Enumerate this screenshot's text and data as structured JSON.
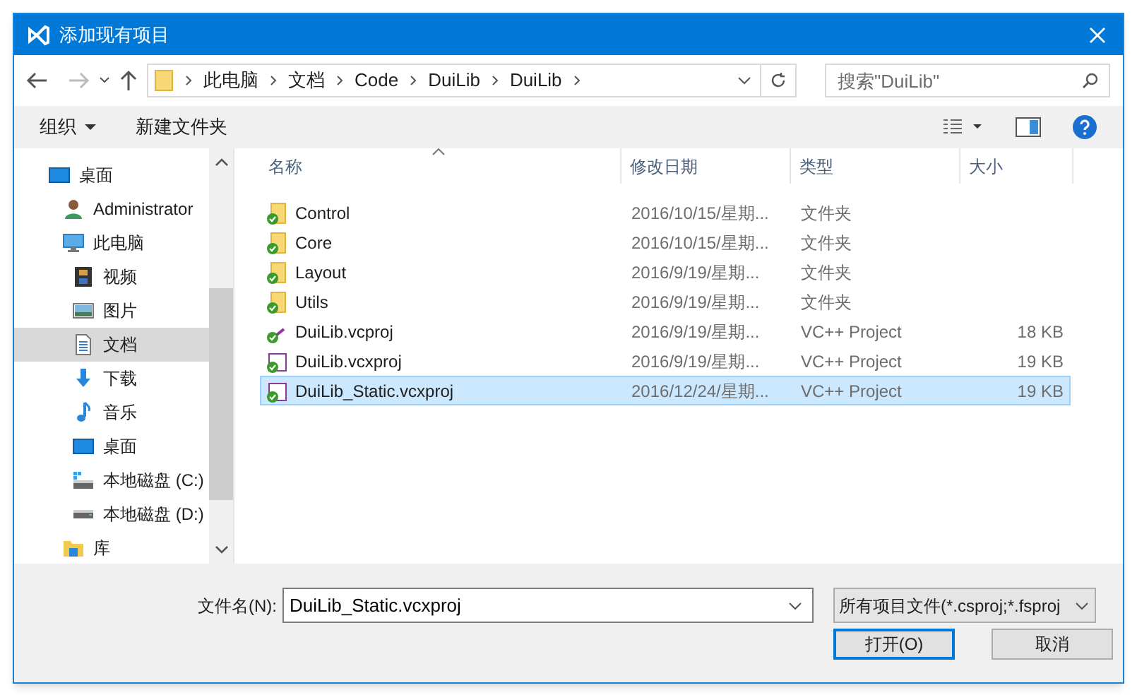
{
  "window": {
    "title": "添加现有项目"
  },
  "address": {
    "segments": [
      "此电脑",
      "文档",
      "Code",
      "DuiLib",
      "DuiLib"
    ]
  },
  "search": {
    "placeholder": "搜索\"DuiLib\""
  },
  "toolbar": {
    "organize": "组织",
    "new_folder": "新建文件夹"
  },
  "sidebar": {
    "items": [
      {
        "label": "桌面",
        "kind": "desktop",
        "selected": false,
        "children": [
          {
            "label": "Administrator",
            "kind": "user",
            "selected": false
          },
          {
            "label": "此电脑",
            "kind": "pc",
            "selected": false,
            "children": [
              {
                "label": "视频",
                "kind": "video",
                "selected": false
              },
              {
                "label": "图片",
                "kind": "image",
                "selected": false
              },
              {
                "label": "文档",
                "kind": "doc",
                "selected": true
              },
              {
                "label": "下载",
                "kind": "download",
                "selected": false
              },
              {
                "label": "音乐",
                "kind": "music",
                "selected": false
              },
              {
                "label": "桌面",
                "kind": "desktop",
                "selected": false
              },
              {
                "label": "本地磁盘 (C:)",
                "kind": "sysdrive",
                "selected": false
              },
              {
                "label": "本地磁盘 (D:)",
                "kind": "drive",
                "selected": false
              }
            ]
          },
          {
            "label": "库",
            "kind": "library",
            "selected": false
          }
        ]
      }
    ]
  },
  "table": {
    "columns": [
      "名称",
      "修改日期",
      "类型",
      "大小"
    ],
    "rows": [
      {
        "kind": "folder",
        "name": "Control",
        "date": "2016/10/15/星期...",
        "type": "文件夹",
        "selected": false
      },
      {
        "kind": "folder",
        "name": "Core",
        "date": "2016/10/15/星期...",
        "type": "文件夹",
        "selected": false
      },
      {
        "kind": "folder",
        "name": "Layout",
        "date": "2016/9/19/星期...",
        "type": "文件夹",
        "selected": false
      },
      {
        "kind": "folder",
        "name": "Utils",
        "date": "2016/9/19/星期...",
        "type": "文件夹",
        "selected": false
      },
      {
        "kind": "vcproj",
        "name": "DuiLib.vcproj",
        "date": "2016/9/19/星期...",
        "type": "VC++ Project",
        "size": "18 KB",
        "selected": false
      },
      {
        "kind": "vcxproj",
        "name": "DuiLib.vcxproj",
        "date": "2016/9/19/星期...",
        "type": "VC++ Project",
        "size": "19 KB",
        "selected": false
      },
      {
        "kind": "vcxproj",
        "name": "DuiLib_Static.vcxproj",
        "date": "2016/12/24/星期...",
        "type": "VC++ Project",
        "size": "19 KB",
        "selected": true
      }
    ]
  },
  "footer": {
    "filename_label": "文件名(N):",
    "filename": "DuiLib_Static.vcxproj",
    "filter": "所有项目文件(*.csproj;*.fsproj",
    "buttons": [
      "打开(O)",
      "取消"
    ]
  }
}
